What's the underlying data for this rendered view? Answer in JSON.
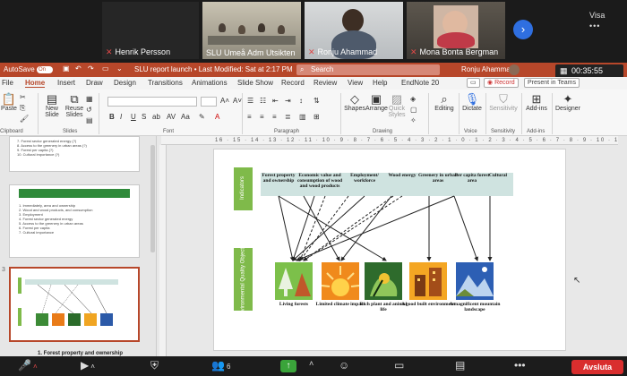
{
  "participants": [
    {
      "name": "Henrik Persson"
    },
    {
      "name": "SLU Umeå Adm Utsikten"
    },
    {
      "name": "Ronju Ahammad"
    },
    {
      "name": "Mona Bonta Bergman"
    }
  ],
  "meeting": {
    "view_label": "Visa",
    "view_dots": "•••",
    "timer": "00:35:55",
    "end_label": "Avsluta",
    "participant_count": "6"
  },
  "app": {
    "autosave_label": "AutoSave",
    "autosave_state": "On",
    "doc_title": "SLU report launch • Last Modified: Sat at 2:17 PM",
    "search_placeholder": "Search",
    "user_name": "Ronju Ahammad"
  },
  "ribbon": {
    "tabs": [
      "File",
      "Home",
      "Insert",
      "Draw",
      "Design",
      "Transitions",
      "Animations",
      "Slide Show",
      "Record",
      "Review",
      "View",
      "Help",
      "EndNote 20"
    ],
    "active_tab": "Home",
    "record_button": "Record",
    "teams_button": "Present in Teams",
    "groups": [
      "Clipboard",
      "Slides",
      "Font",
      "Paragraph",
      "Drawing",
      "Voice",
      "Sensitivity",
      "Add-ins"
    ],
    "buttons": {
      "paste": "Paste",
      "new_slide": "New Slide",
      "reuse_slides": "Reuse Slides",
      "shapes": "Shapes",
      "arrange": "Arrange",
      "quick_styles": "Quick Styles",
      "editing": "Editing",
      "dictate": "Dictate",
      "sensitivity": "Sensitivity",
      "add_ins": "Add-ins",
      "designer": "Designer"
    }
  },
  "thumbnails": {
    "slide1_lines": [
      "7. Forest sector generated energy (?)",
      "8. Access to the greenery in urban areas (?)",
      "9. Forest per capita (?)",
      "10. Cultural importance (?)"
    ],
    "slide2_lines": [
      "1. Immediately, area and ownership",
      "2. Wood and wood products, and consumption",
      "3. Employment",
      "4. Forest sector generated energy",
      "5. Access to the greenery in urban areas",
      "6. Forest per capita",
      "7. Cultural importance"
    ],
    "slide3_number": "3",
    "caption": "1. Forest property and ownership"
  },
  "ruler_text": "16 · 15 · 14 · 13 · 12 · 11 · 10 · 9 · 8 · 7 · 6 · 5 · 4 · 3 · 2 · 1 · 0 · 1 · 2 · 3 · 4 · 5 · 6 · 7 · 8 · 9 · 10 · 11 · 12 · 13 · 14 · 15 · 16",
  "slide": {
    "indicators_label": "Indicators",
    "env_label": "Environmental Quality Objectives",
    "indicators": [
      "Forest property and ownership",
      "Economic value and consumption of wood and wood products",
      "Employment/ workforce",
      "Wood energy",
      "Greenery in urban areas",
      "Per capita forest area",
      "Cultural"
    ],
    "objectives": [
      "Living forests",
      "Limited climate impact",
      "Rich plant and animal life",
      "A good built environment",
      "A magnificent mountain landscape"
    ]
  }
}
